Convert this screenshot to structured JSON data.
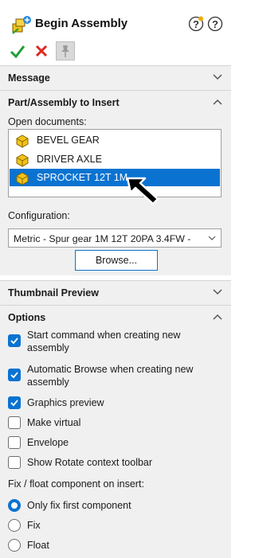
{
  "header": {
    "title": "Begin Assembly",
    "assembly_icon": "assembly-icon",
    "help_icons": [
      "question-gear-icon",
      "question-icon"
    ]
  },
  "actions": {
    "ok_icon": "checkmark-icon",
    "cancel_icon": "x-icon",
    "pin_icon": "pushpin-icon"
  },
  "sections": {
    "message": {
      "label": "Message",
      "expanded": false
    },
    "part_insert": {
      "label": "Part/Assembly to Insert",
      "expanded": true
    },
    "thumbnail": {
      "label": "Thumbnail Preview",
      "expanded": false
    },
    "options": {
      "label": "Options",
      "expanded": true
    }
  },
  "part_insert": {
    "open_docs_label": "Open documents:",
    "documents": [
      {
        "label": "BEVEL GEAR",
        "selected": false
      },
      {
        "label": "DRIVER AXLE",
        "selected": false
      },
      {
        "label": "SPROCKET 12T 1M",
        "selected": true
      }
    ],
    "configuration_label": "Configuration:",
    "configuration_value": "Metric - Spur gear 1M 12T 20PA 3.4FW -",
    "browse_label": "Browse..."
  },
  "options": {
    "checkboxes": [
      {
        "label_line1": "Start command when creating new",
        "label_line2": "assembly",
        "checked": true
      },
      {
        "label_line1": "Automatic Browse when creating new",
        "label_line2": "assembly",
        "checked": true
      },
      {
        "label_line1": "Graphics preview",
        "label_line2": "",
        "checked": true
      },
      {
        "label_line1": "Make virtual",
        "label_line2": "",
        "checked": false
      },
      {
        "label_line1": "Envelope",
        "label_line2": "",
        "checked": false
      },
      {
        "label_line1": "Show Rotate context toolbar",
        "label_line2": "",
        "checked": false
      }
    ],
    "fix_label": "Fix / float component on insert:",
    "radios": [
      {
        "label": "Only fix first component",
        "selected": true
      },
      {
        "label": "Fix",
        "selected": false
      },
      {
        "label": "Float",
        "selected": false
      }
    ]
  },
  "colors": {
    "accent": "#0a73d1",
    "section_bg": "#f0f0f0",
    "ok_green": "#1e9e35",
    "cancel_red": "#e0281e",
    "part_yellow": "#f2c319"
  }
}
